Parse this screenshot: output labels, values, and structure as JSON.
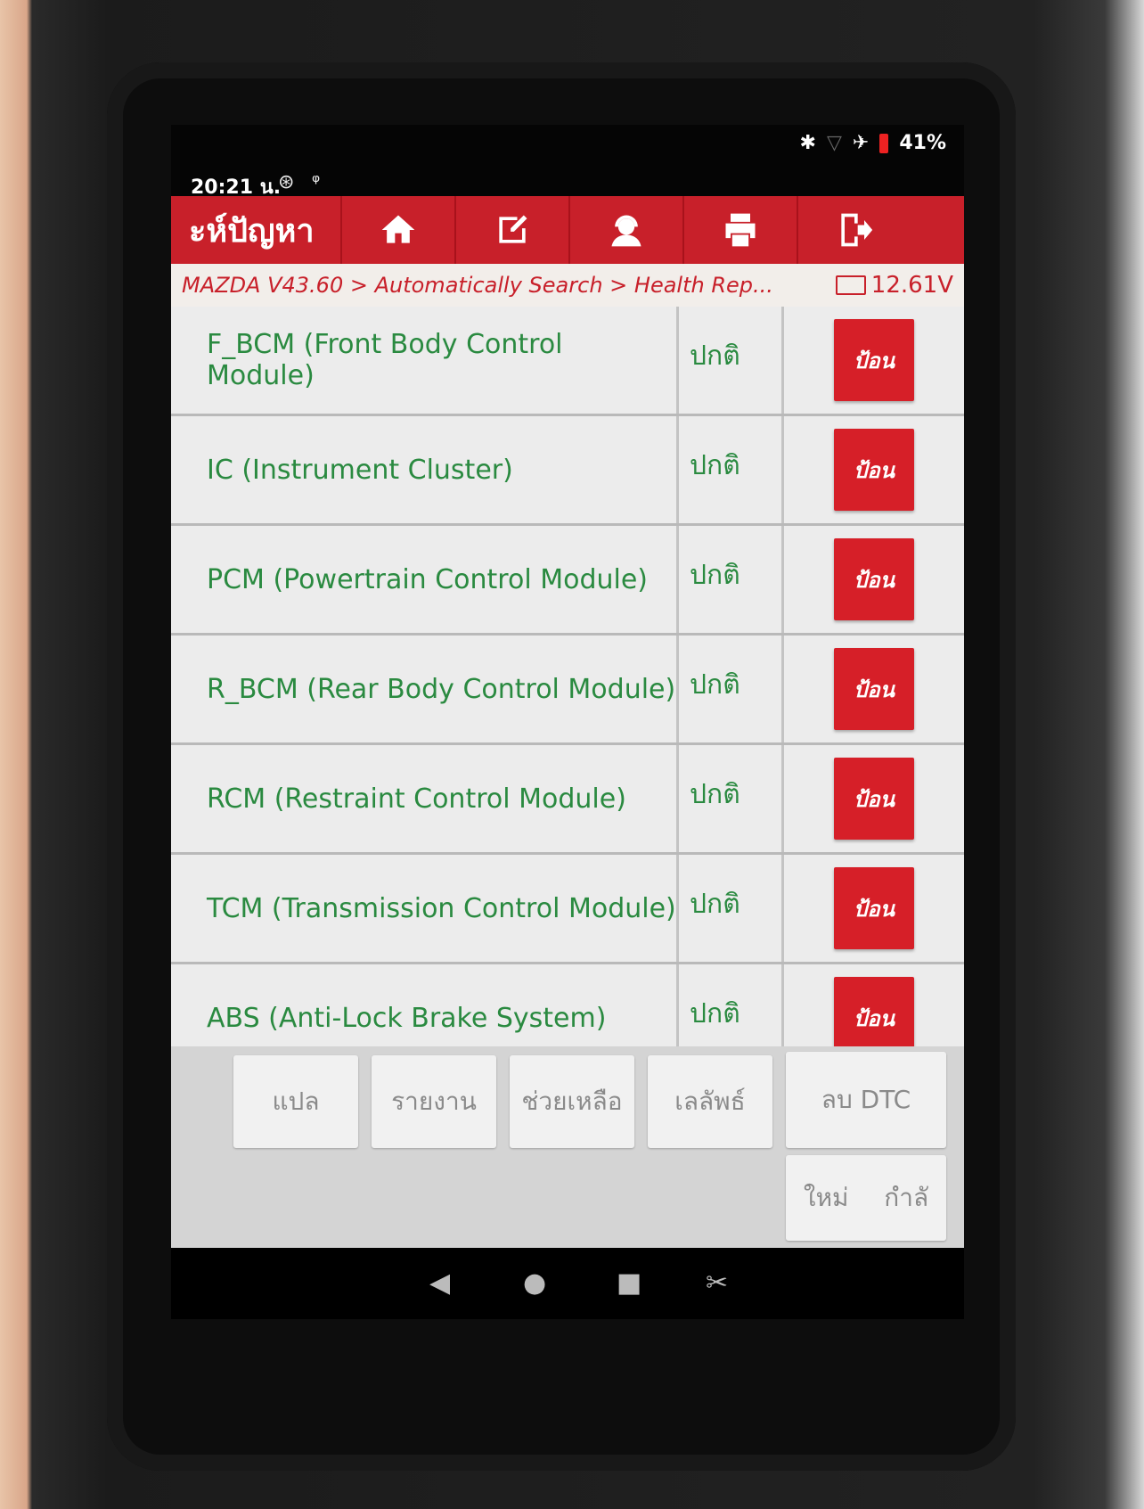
{
  "status_bar": {
    "time": "20:21 น.",
    "battery": "41%"
  },
  "header": {
    "title": "ะห์ปัญหา",
    "icons": [
      "home-icon",
      "edit-icon",
      "support-icon",
      "print-icon",
      "exit-icon"
    ]
  },
  "breadcrumb": {
    "path": "MAZDA V43.60 > Automatically Search > Health Rep...",
    "voltage": "12.61V"
  },
  "modules": [
    {
      "name": "F_BCM (Front Body Control Module)",
      "status": "ปกติ",
      "action": "ป้อน"
    },
    {
      "name": "IC (Instrument Cluster)",
      "status": "ปกติ",
      "action": "ป้อน"
    },
    {
      "name": "PCM (Powertrain Control Module)",
      "status": "ปกติ",
      "action": "ป้อน"
    },
    {
      "name": "R_BCM (Rear Body Control Module)",
      "status": "ปกติ",
      "action": "ป้อน"
    },
    {
      "name": "RCM (Restraint Control Module)",
      "status": "ปกติ",
      "action": "ป้อน"
    },
    {
      "name": "TCM (Transmission Control Module)",
      "status": "ปกติ",
      "action": "ป้อน"
    },
    {
      "name": "ABS (Anti-Lock Brake System)",
      "status": "ปกติ",
      "action": "ป้อน"
    }
  ],
  "actions": {
    "translate": "แปล",
    "report": "รายงาน",
    "help": "ช่วยเหลือ",
    "serial": "เลลัพธ์",
    "clear_dtc": "ลบ DTC",
    "new": "ใหม่",
    "history": "กำลั"
  },
  "colors": {
    "accent": "#c8202a",
    "module_text": "#2a8a40"
  }
}
